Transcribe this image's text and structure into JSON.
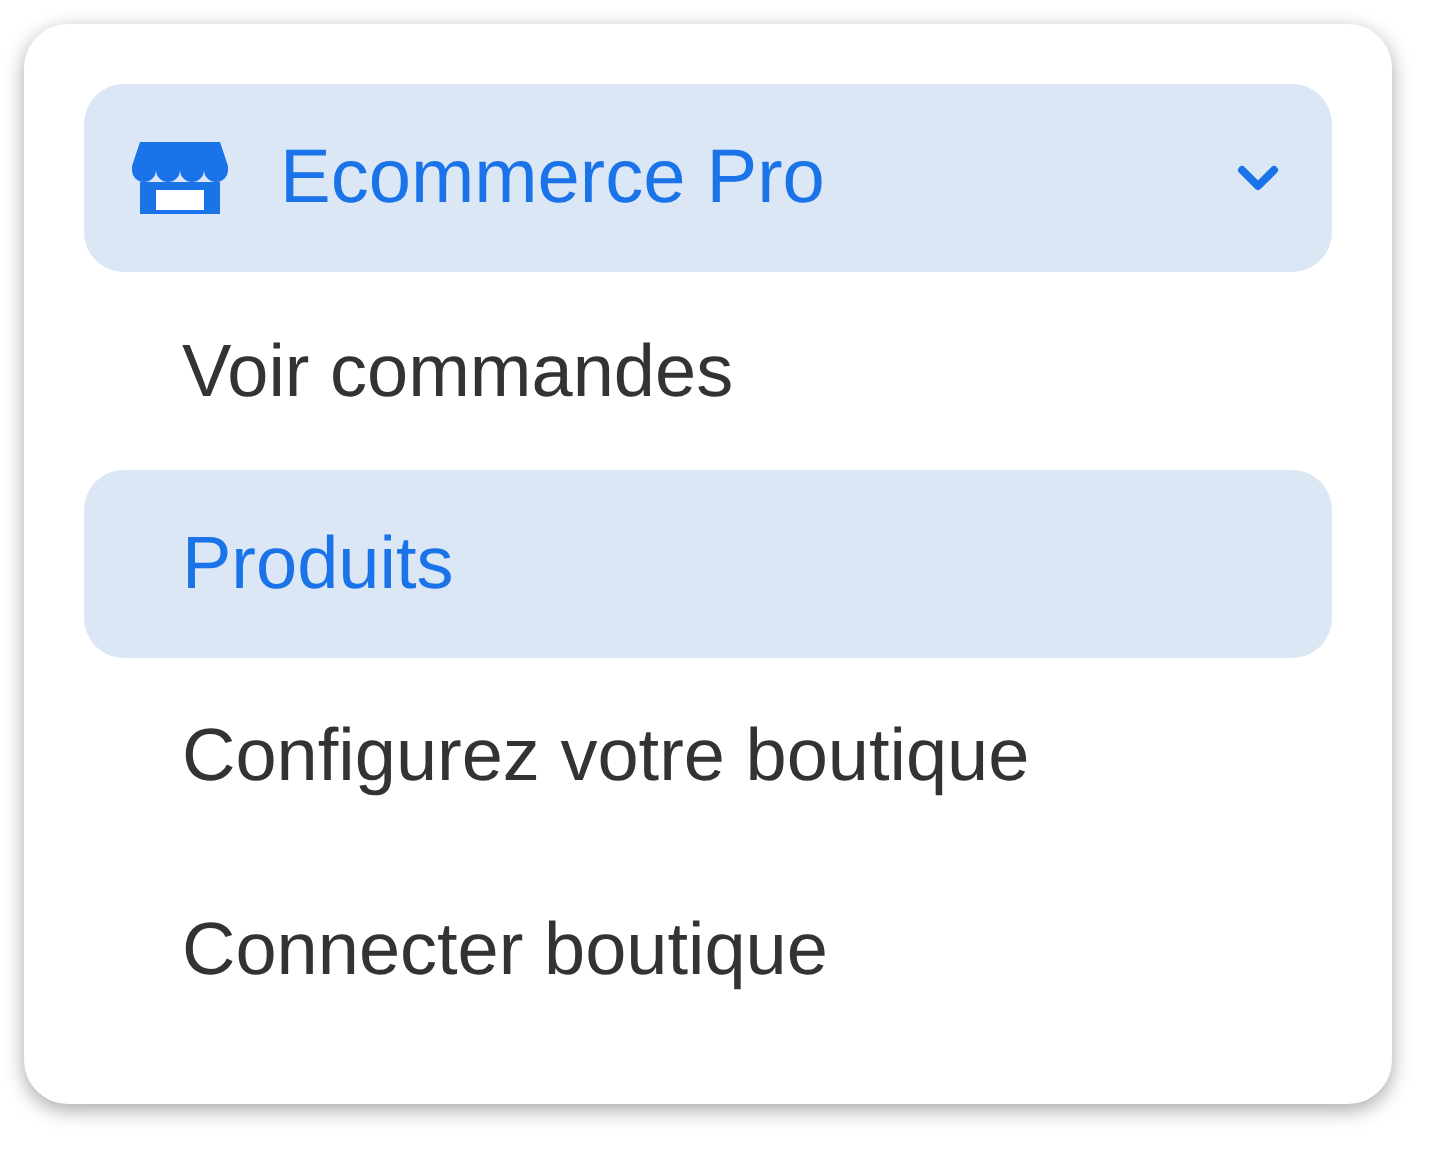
{
  "menu": {
    "title": "Ecommerce Pro",
    "expanded": true,
    "selected": true,
    "items": [
      {
        "label": "Voir commandes",
        "selected": false
      },
      {
        "label": "Produits",
        "selected": true
      },
      {
        "label": "Configurez votre boutique",
        "selected": false
      },
      {
        "label": "Connecter boutique",
        "selected": false
      }
    ]
  }
}
